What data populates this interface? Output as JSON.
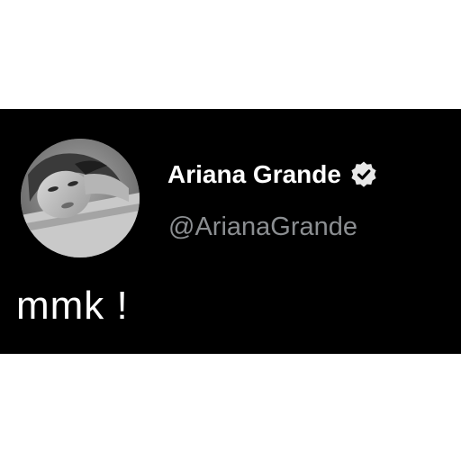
{
  "tweet": {
    "author": {
      "display_name": "Ariana Grande",
      "handle": "@ArianaGrande",
      "verified": true,
      "avatar_icon": "profile-photo"
    },
    "text": "mmk !"
  },
  "colors": {
    "card_background": "#000000",
    "page_background": "#ffffff",
    "name_text": "#ffffff",
    "handle_text": "#8b8e91",
    "verified_badge": "#e8e8e8"
  }
}
